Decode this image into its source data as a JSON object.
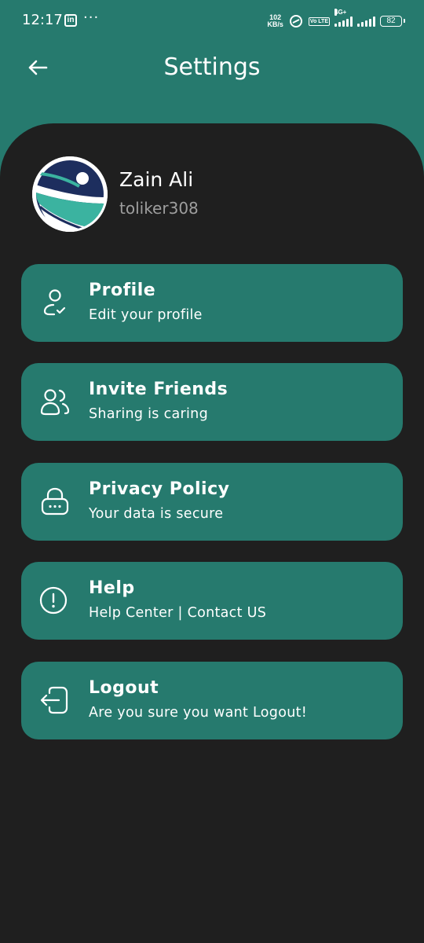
{
  "status_bar": {
    "time": "12:17",
    "linkedin_icon": "in",
    "more_dots": "···",
    "net_speed_value": "102",
    "net_speed_unit": "KB/s",
    "volte_label": "Vo LTE",
    "network_gen": "4G+",
    "battery_level": "82"
  },
  "header": {
    "title": "Settings",
    "back_icon": "arrow-left-icon"
  },
  "profile": {
    "name": "Zain Ali",
    "username": "toliker308"
  },
  "menu": [
    {
      "title": "Profile",
      "subtitle": "Edit your profile",
      "icon": "user-check-icon"
    },
    {
      "title": "Invite Friends",
      "subtitle": "Sharing is caring",
      "icon": "users-icon"
    },
    {
      "title": "Privacy Policy",
      "subtitle": "Your data is secure",
      "icon": "lock-icon"
    },
    {
      "title": "Help",
      "subtitle": "Help Center | Contact US",
      "icon": "alert-circle-icon"
    },
    {
      "title": "Logout",
      "subtitle": "Are you sure you want Logout!",
      "icon": "logout-icon"
    }
  ],
  "colors": {
    "accent": "#267a6e",
    "background": "#1f1f1f",
    "avatar_navy": "#1d2e5e",
    "avatar_teal": "#3bb3a0"
  }
}
